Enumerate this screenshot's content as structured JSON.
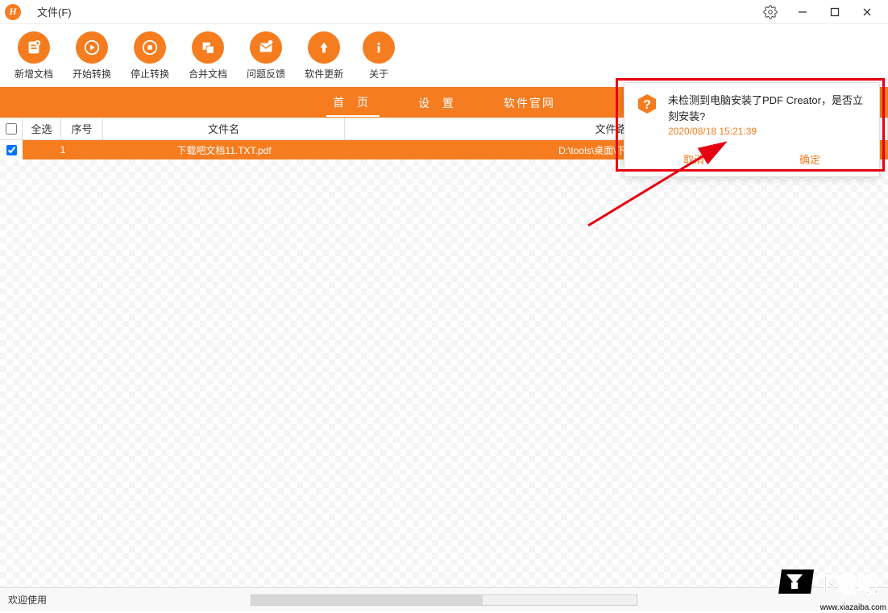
{
  "titlebar": {
    "logo_letter": "H",
    "file_menu": "文件(F)"
  },
  "toolbar": [
    {
      "id": "new-doc",
      "label": "新增文档"
    },
    {
      "id": "start-convert",
      "label": "开始转换"
    },
    {
      "id": "stop-convert",
      "label": "停止转换"
    },
    {
      "id": "merge-doc",
      "label": "合并文档"
    },
    {
      "id": "feedback",
      "label": "问题反馈"
    },
    {
      "id": "update",
      "label": "软件更新"
    },
    {
      "id": "about",
      "label": "关于"
    }
  ],
  "tabs": {
    "home": "首  页",
    "settings": "设  置",
    "website": "软件官网"
  },
  "table": {
    "select_all": "全选",
    "col_index": "序号",
    "col_name": "文件名",
    "col_path": "文件路径",
    "rows": [
      {
        "checked": true,
        "index": "1",
        "name": "下载吧文档11.TXT.pdf",
        "path": "D:\\tools\\桌面\\下载吧文档11"
      }
    ]
  },
  "popup": {
    "message": "未检测到电脑安装了PDF Creator，是否立刻安装?",
    "timestamp": "2020/08/18 15:21:39",
    "cancel": "取消",
    "confirm": "确定"
  },
  "statusbar": {
    "welcome": "欢迎使用"
  },
  "watermark": {
    "text": "下载吧",
    "url": "www.xiazaiba.com"
  }
}
